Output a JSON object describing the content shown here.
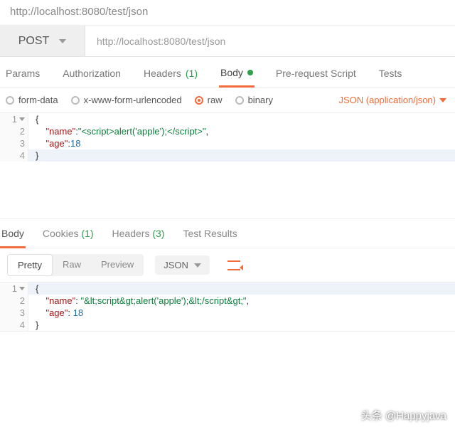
{
  "url_display": "http://localhost:8080/test/json",
  "request": {
    "method": "POST",
    "url": "http://localhost:8080/test/json",
    "tabs": {
      "params": "Params",
      "auth": "Authorization",
      "headers": "Headers",
      "headers_count": "(1)",
      "body": "Body",
      "prerequest": "Pre-request Script",
      "tests": "Tests"
    },
    "body_types": {
      "formdata": "form-data",
      "urlencoded": "x-www-form-urlencoded",
      "raw": "raw",
      "binary": "binary"
    },
    "content_type": "JSON (application/json)",
    "editor_lines": [
      {
        "n": "1",
        "text": "{",
        "fold": true,
        "hl": false
      },
      {
        "n": "2",
        "fold": false,
        "hl": false,
        "segments": [
          {
            "t": "    ",
            "c": ""
          },
          {
            "t": "\"name\"",
            "c": "k-key"
          },
          {
            "t": ":",
            "c": ""
          },
          {
            "t": "\"<script>alert('apple');</script>\"",
            "c": "k-str"
          },
          {
            "t": ",",
            "c": ""
          }
        ]
      },
      {
        "n": "3",
        "fold": false,
        "hl": false,
        "segments": [
          {
            "t": "    ",
            "c": ""
          },
          {
            "t": "\"age\"",
            "c": "k-key"
          },
          {
            "t": ":",
            "c": ""
          },
          {
            "t": "18",
            "c": "k-num"
          }
        ]
      },
      {
        "n": "4",
        "text": "}",
        "fold": false,
        "hl": true
      }
    ]
  },
  "response": {
    "tabs": {
      "body": "Body",
      "cookies": "Cookies",
      "cookies_count": "(1)",
      "headers": "Headers",
      "headers_count": "(3)",
      "test_results": "Test Results"
    },
    "views": {
      "pretty": "Pretty",
      "raw": "Raw",
      "preview": "Preview"
    },
    "format": "JSON",
    "editor_lines": [
      {
        "n": "1",
        "text": "{",
        "fold": true,
        "hl": true
      },
      {
        "n": "2",
        "fold": false,
        "hl": false,
        "segments": [
          {
            "t": "    ",
            "c": ""
          },
          {
            "t": "\"name\"",
            "c": "k-key"
          },
          {
            "t": ": ",
            "c": ""
          },
          {
            "t": "\"&lt;script&gt;alert('apple');&lt;/script&gt;\"",
            "c": "k-html"
          },
          {
            "t": ",",
            "c": ""
          }
        ]
      },
      {
        "n": "3",
        "fold": false,
        "hl": false,
        "segments": [
          {
            "t": "    ",
            "c": ""
          },
          {
            "t": "\"age\"",
            "c": "k-key"
          },
          {
            "t": ": ",
            "c": ""
          },
          {
            "t": "18",
            "c": "k-num"
          }
        ]
      },
      {
        "n": "4",
        "text": "}",
        "fold": false,
        "hl": false
      }
    ]
  },
  "watermark": "头条 @Happyjava"
}
